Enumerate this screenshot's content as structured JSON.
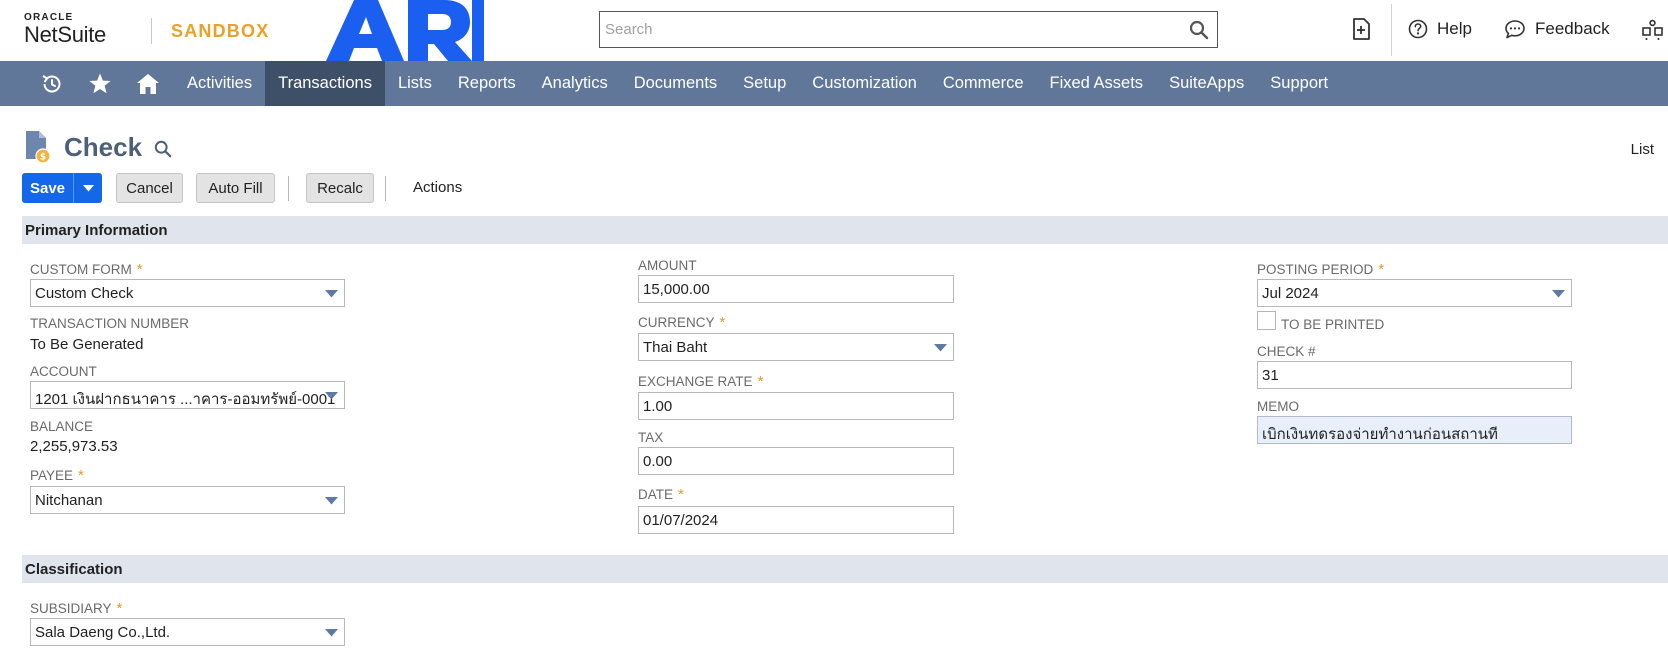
{
  "header": {
    "oracle_label": "ORACLE",
    "netsuite_label": "NetSuite",
    "sandbox_label": "SANDBOX",
    "search_placeholder": "Search",
    "help_label": "Help",
    "feedback_label": "Feedback"
  },
  "nav": {
    "items": [
      "Activities",
      "Transactions",
      "Lists",
      "Reports",
      "Analytics",
      "Documents",
      "Setup",
      "Customization",
      "Commerce",
      "Fixed Assets",
      "SuiteApps",
      "Support"
    ],
    "active": "Transactions"
  },
  "page": {
    "title": "Check",
    "list_link": "List"
  },
  "buttons": {
    "save": "Save",
    "cancel": "Cancel",
    "auto_fill": "Auto Fill",
    "recalc": "Recalc",
    "actions": "Actions"
  },
  "sections": {
    "primary": "Primary Information",
    "classification": "Classification"
  },
  "fields": {
    "custom_form": {
      "label": "Custom Form",
      "value": "Custom Check"
    },
    "transaction_number": {
      "label": "Transaction Number",
      "value": "To Be Generated"
    },
    "account": {
      "label": "Account",
      "value": "1201 เงินฝากธนาคาร ...าคาร-ออมทรัพย์-0001"
    },
    "balance": {
      "label": "Balance",
      "value": "2,255,973.53"
    },
    "payee": {
      "label": "Payee",
      "value": "Nitchanan"
    },
    "amount": {
      "label": "Amount",
      "value": "15,000.00"
    },
    "currency": {
      "label": "Currency",
      "value": "Thai Baht"
    },
    "exchange_rate": {
      "label": "Exchange Rate",
      "value": "1.00"
    },
    "tax": {
      "label": "Tax",
      "value": "0.00"
    },
    "date": {
      "label": "Date",
      "value": "01/07/2024"
    },
    "posting_period": {
      "label": "Posting Period",
      "value": "Jul 2024"
    },
    "to_be_printed": {
      "label": "To Be Printed",
      "checked": false
    },
    "check_number": {
      "label": "Check #",
      "value": "31"
    },
    "memo": {
      "label": "Memo",
      "value": "เบิกเงินทดรองจ่ายทำงานก่อนสถานที"
    },
    "subsidiary": {
      "label": "Subsidiary",
      "value": "Sala Daeng Co.,Ltd."
    }
  },
  "colors": {
    "nav_bg": "#607799",
    "nav_active": "#3e5068",
    "primary_button": "#1467e8",
    "required_star": "#e29a2d",
    "section_bg": "#e0e5ed",
    "sandbox": "#e9a12a",
    "ari_logo": "#1a5ff0"
  },
  "icons": [
    "search-icon",
    "new-record-icon",
    "help-icon",
    "feedback-icon",
    "role-switch-icon",
    "recent-records-icon",
    "favorites-star-icon",
    "home-icon",
    "check-record-icon",
    "dropdown-caret-icon"
  ]
}
